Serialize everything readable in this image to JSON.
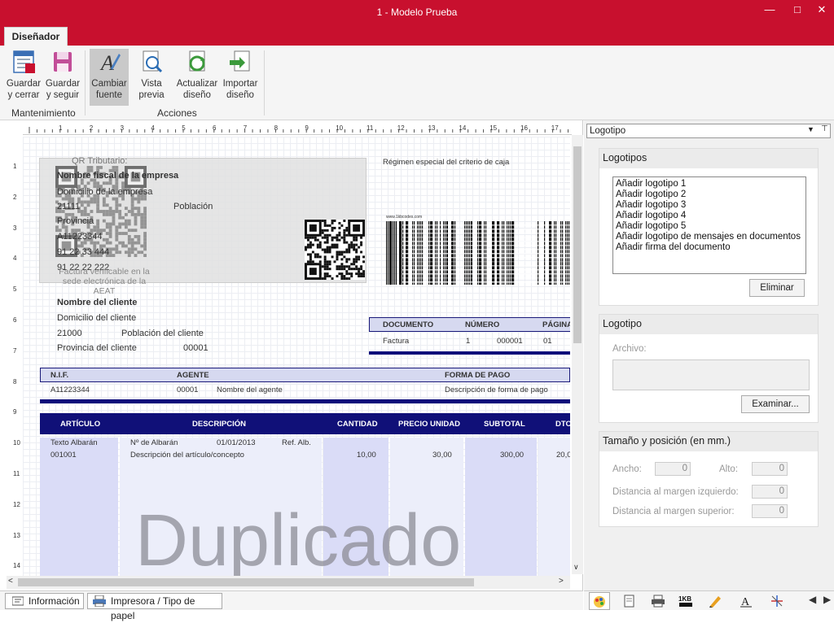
{
  "window": {
    "title": "1 - Modelo Prueba",
    "minimize": "—",
    "maximize": "□",
    "close": "✕"
  },
  "ribbon": {
    "tab": "Diseñador",
    "buttons": {
      "save_close": [
        "Guardar",
        "y cerrar"
      ],
      "save_continue": [
        "Guardar",
        "y seguir"
      ],
      "change_font": [
        "Cambiar",
        "fuente"
      ],
      "preview": [
        "Vista",
        "previa"
      ],
      "update": [
        "Actualizar",
        "diseño"
      ],
      "import": [
        "Importar",
        "diseño"
      ]
    },
    "groups": {
      "maintenance": "Mantenimiento",
      "actions": "Acciones"
    }
  },
  "ruler": {
    "h_labels": [
      "1",
      "2",
      "3",
      "4",
      "5",
      "6",
      "7",
      "8",
      "9",
      "10",
      "11",
      "12",
      "13",
      "14",
      "15",
      "16",
      "17"
    ],
    "v_labels": [
      "1",
      "2",
      "3",
      "4",
      "5",
      "6",
      "7",
      "8",
      "9",
      "10",
      "11",
      "12",
      "13",
      "14"
    ]
  },
  "document": {
    "qr_label": "QR Tributario:",
    "company": {
      "name": "Nombre fiscal de la empresa",
      "address": "Domicilio de la empresa",
      "zip": "21111",
      "city": "Población",
      "province": "Provincia",
      "nif": "A11223344",
      "phone": "91 22 33 444",
      "fax": "91 22 22 222"
    },
    "verify_note": [
      "Factura verificable en la",
      "sede electrónica de la",
      "AEAT"
    ],
    "regime": "Régimen especial del criterio de caja",
    "barcode_url": "www.1kbcodes.com",
    "client": {
      "name": "Nombre del cliente",
      "address": "Domicilio del cliente",
      "zip": "21000",
      "city": "Población del cliente",
      "province": "Provincia del cliente",
      "code": "00001"
    },
    "doc_table": {
      "headers": [
        "DOCUMENTO",
        "NÚMERO",
        "PÁGINA"
      ],
      "row": [
        "Factura",
        "1",
        "000001",
        "01"
      ]
    },
    "nif_table": {
      "headers": [
        "N.I.F.",
        "AGENTE",
        "FORMA DE PAGO"
      ],
      "row": [
        "A11223344",
        "00001",
        "Nombre del agente",
        "Descripción de forma de pago"
      ]
    },
    "lines_table": {
      "headers": [
        "ARTÍCULO",
        "DESCRIPCIÓN",
        "CANTIDAD",
        "PRECIO UNIDAD",
        "SUBTOTAL",
        "DTO."
      ],
      "row1": [
        "Texto Albarán",
        "Nº de Albarán",
        "01/01/2013",
        "Ref. Alb."
      ],
      "row2": [
        "001001",
        "Descripción del artículo/concepto",
        "10,00",
        "30,00",
        "300,00",
        "20,0"
      ]
    },
    "watermark": "Duplicado"
  },
  "bottom_tabs": [
    "Información",
    "Impresora / Tipo de papel"
  ],
  "panel": {
    "dropdown": "Logotipo",
    "logos": {
      "title": "Logotipos",
      "items": [
        "Añadir logotipo 1",
        "Añadir logotipo 2",
        "Añadir logotipo 3",
        "Añadir logotipo 4",
        "Añadir logotipo 5",
        "Añadir logotipo de mensajes en documentos",
        "Añadir firma del documento"
      ],
      "remove": "Eliminar"
    },
    "logo": {
      "title": "Logotipo",
      "file_label": "Archivo:",
      "browse": "Examinar..."
    },
    "size": {
      "title": "Tamaño y posición (en mm.)",
      "width_label": "Ancho:",
      "width": "0",
      "height_label": "Alto:",
      "height": "0",
      "left_label": "Distancia al margen izquierdo:",
      "left": "0",
      "top_label": "Distancia al margen superior:",
      "top": "0"
    }
  },
  "panel_icons": [
    "palette-icon",
    "page-icon",
    "printer-icon",
    "barcode-1kb-icon",
    "pen-icon",
    "text-a-icon",
    "compass-icon",
    "arrow-left-icon",
    "arrow-right-icon"
  ]
}
